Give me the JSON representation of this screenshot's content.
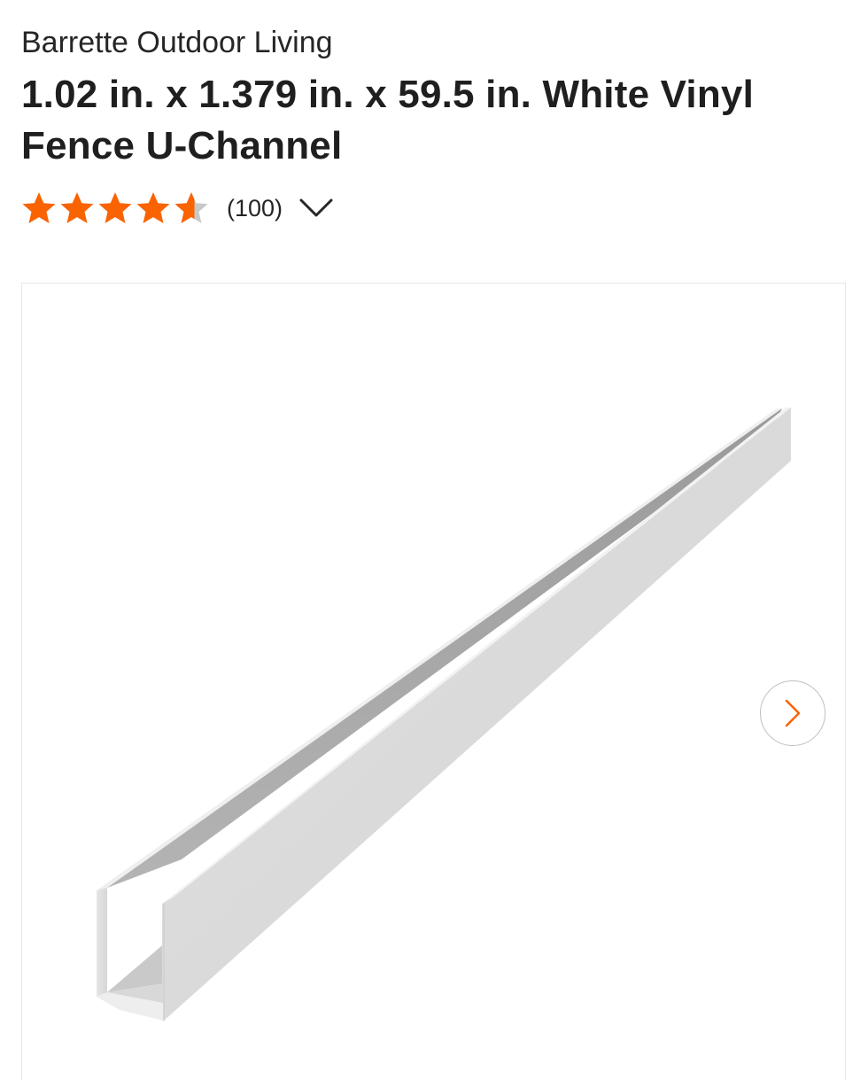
{
  "product": {
    "brand": "Barrette Outdoor Living",
    "title": "1.02 in. x 1.379 in. x 59.5 in. White Vinyl Fence U-Channel"
  },
  "rating": {
    "value": 4.6,
    "max": 5,
    "review_count": "(100)",
    "star_icon": "star-icon",
    "expand_icon": "chevron-down-icon"
  },
  "gallery": {
    "image_alt": "White vinyl fence U-channel",
    "next_icon": "chevron-right-icon"
  },
  "colors": {
    "star_filled": "#f96302",
    "star_empty": "#c8c8c8",
    "accent": "#f96302",
    "text": "#1f1f1f"
  }
}
